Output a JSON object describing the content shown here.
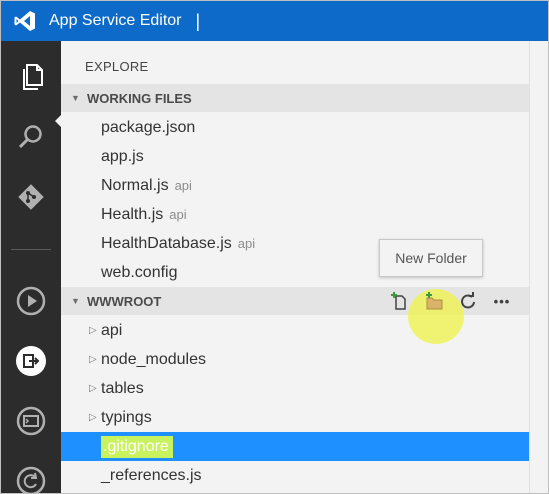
{
  "window": {
    "title": "App Service Editor",
    "title_cursor": "|",
    "brand_color": "#0e6ac8"
  },
  "activity_bar": {
    "items": [
      {
        "name": "explorer-icon",
        "active": true
      },
      {
        "name": "search-icon",
        "active": false
      },
      {
        "name": "git-icon",
        "active": false
      },
      {
        "name": "run-icon",
        "active": false
      },
      {
        "name": "console-icon",
        "active": false
      },
      {
        "name": "terminal-icon",
        "active": false
      },
      {
        "name": "refresh-icon",
        "active": false
      }
    ]
  },
  "explorer": {
    "title": "EXPLORE",
    "working_files": {
      "header": "WORKING FILES",
      "items": [
        {
          "name": "package.json",
          "hint": ""
        },
        {
          "name": "app.js",
          "hint": ""
        },
        {
          "name": "Normal.js",
          "hint": "api"
        },
        {
          "name": "Health.js",
          "hint": "api"
        },
        {
          "name": "HealthDatabase.js",
          "hint": "api"
        },
        {
          "name": "web.config",
          "hint": ""
        }
      ]
    },
    "wwwroot": {
      "header": "WWWROOT",
      "actions": [
        "new-file-icon",
        "new-folder-icon",
        "refresh-icon",
        "more-icon"
      ],
      "more_label": "•••",
      "items": [
        {
          "name": "api",
          "type": "folder"
        },
        {
          "name": "node_modules",
          "type": "folder"
        },
        {
          "name": "tables",
          "type": "folder"
        },
        {
          "name": "typings",
          "type": "folder"
        },
        {
          "name": ".gitignore",
          "type": "file",
          "selected": true
        },
        {
          "name": "_references.js",
          "type": "file"
        }
      ]
    },
    "tooltip": "New Folder",
    "selection_color": "#1e90ff",
    "highlight_color": "#eef25a"
  }
}
